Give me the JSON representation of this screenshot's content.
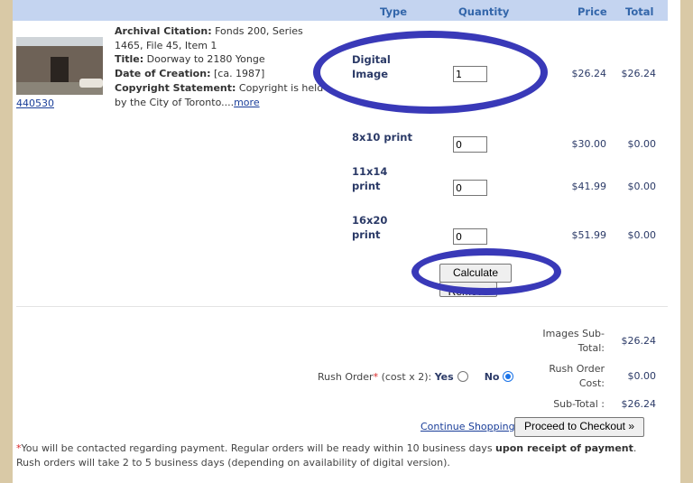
{
  "header": {
    "type": "Type",
    "quantity": "Quantity",
    "price": "Price",
    "total": "Total"
  },
  "item": {
    "id": "440530",
    "citation_label": "Archival Citation:",
    "citation_value": "Fonds 200, Series 1465, File 45, Item 1",
    "title_label": "Title:",
    "title_value": "Doorway to 2180 Yonge",
    "date_label": "Date of Creation:",
    "date_value": "[ca. 1987]",
    "copyright_label": "Copyright Statement:",
    "copyright_value": "Copyright is held by the City of Toronto....",
    "more_link": "more"
  },
  "rows": [
    {
      "type": "Digital Image",
      "quantity": "1",
      "price": "$26.24",
      "total": "$26.24"
    },
    {
      "type": "8x10 print",
      "quantity": "0",
      "price": "$30.00",
      "total": "$0.00"
    },
    {
      "type": "11x14 print",
      "quantity": "0",
      "price": "$41.99",
      "total": "$0.00"
    },
    {
      "type": "16x20 print",
      "quantity": "0",
      "price": "$51.99",
      "total": "$0.00"
    }
  ],
  "buttons": {
    "calculate": "Calculate",
    "remove": "Remove",
    "continue_shopping": "Continue Shopping",
    "checkout": "Proceed to Checkout »"
  },
  "summary": {
    "images_subtotal_label": "Images Sub-Total:",
    "images_subtotal_value": "$26.24",
    "rush_cost_label": "Rush Order Cost:",
    "rush_cost_value": "$0.00",
    "subtotal_label": "Sub-Total :",
    "subtotal_value": "$26.24"
  },
  "rush": {
    "label": "Rush Order",
    "required_mark": "*",
    "note": "(cost x 2):",
    "yes": "Yes",
    "no": "No",
    "selected": "No"
  },
  "footnote": {
    "mark": "*",
    "text1": "You will be contacted regarding payment. Regular orders will be ready within 10 business days ",
    "bold": "upon receipt of payment",
    "text2": ". Rush orders will take 2 to 5 business days (depending on availability of digital version)."
  },
  "colors": {
    "header_bg": "#c4d4f0",
    "header_text": "#3366aa",
    "annotation_oval": "#3939b8",
    "required": "#d92626",
    "link": "#1a3e99"
  }
}
